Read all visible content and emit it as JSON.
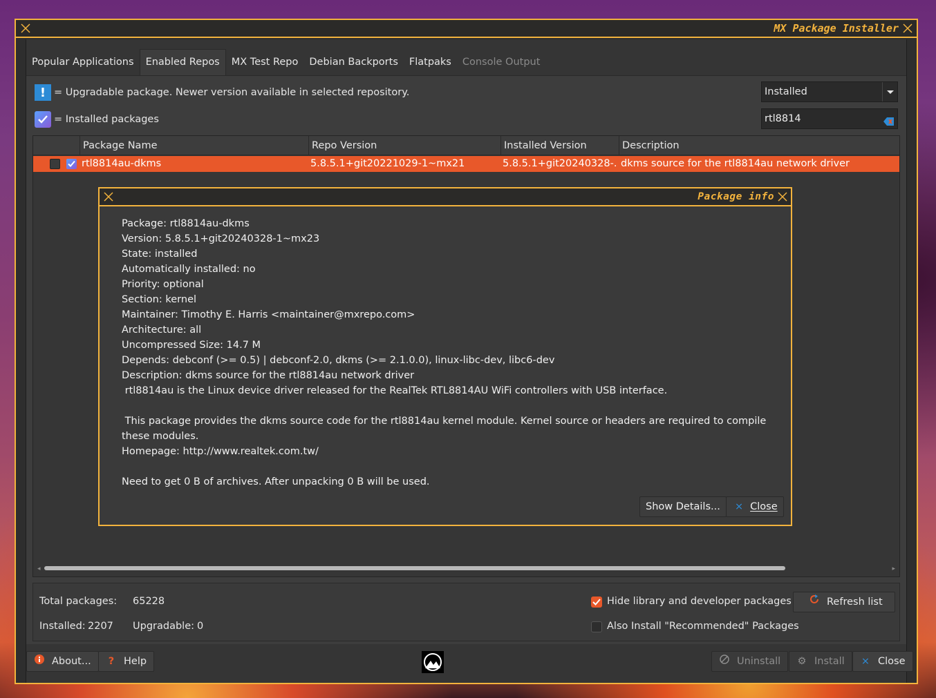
{
  "window": {
    "title": "MX Package Installer"
  },
  "tabs": [
    {
      "label": "Popular Applications"
    },
    {
      "label": "Enabled Repos"
    },
    {
      "label": "MX Test Repo"
    },
    {
      "label": "Debian Backports"
    },
    {
      "label": "Flatpaks"
    },
    {
      "label": "Console Output"
    }
  ],
  "legend": {
    "upgradable_icon": "!",
    "upgradable": "= Upgradable package. Newer version available in selected repository.",
    "installed": "= Installed packages"
  },
  "filter": {
    "selected": "Installed"
  },
  "search": {
    "value": "rtl8814"
  },
  "table": {
    "headers": [
      "Package Name",
      "Repo Version",
      "Installed Version",
      "Description"
    ],
    "rows": [
      {
        "name": "rtl8814au-dkms",
        "repo_version": "5.8.5.1+git20221029-1~mx21",
        "installed_version": "5.8.5.1+git20240328-...",
        "description": "dkms source for the rtl8814au network driver",
        "selected": false,
        "installed": true
      }
    ]
  },
  "stats": {
    "total_label": "Total packages:",
    "total_value": "65228",
    "installed_label": "Installed:",
    "installed_value": "2207",
    "upgradable_label": "Upgradable:",
    "upgradable_value": "0"
  },
  "options": {
    "hide_lib": "Hide library and developer packages",
    "hide_lib_checked": true,
    "recommended": "Also Install \"Recommended\" Packages",
    "recommended_checked": false
  },
  "buttons": {
    "refresh": "Refresh list",
    "about": "About...",
    "help": "Help",
    "uninstall": "Uninstall",
    "install": "Install",
    "close": "Close"
  },
  "dialog": {
    "title": "Package info",
    "lines": [
      "Package: rtl8814au-dkms",
      "Version: 5.8.5.1+git20240328-1~mx23",
      "State: installed",
      "Automatically installed: no",
      "Priority: optional",
      "Section: kernel",
      "Maintainer: Timothy E. Harris <maintainer@mxrepo.com>",
      "Architecture: all",
      "Uncompressed Size: 14.7 M",
      "Depends: debconf (>= 0.5) | debconf-2.0, dkms (>= 2.1.0.0), linux-libc-dev, libc6-dev",
      "Description: dkms source for the rtl8814au network driver",
      " rtl8814au is the Linux device driver released for the RealTek RTL8814AU WiFi controllers with USB interface.",
      " ",
      " This package provides the dkms source code for the rtl8814au kernel module. Kernel source or headers are required to compile these modules.",
      "Homepage: http://www.realtek.com.tw/",
      " ",
      "Need to get 0 B of archives. After unpacking 0 B will be used."
    ],
    "show_details": "Show Details...",
    "close": "Close"
  },
  "colors": {
    "accent": "#f3b33d",
    "selection": "#e8582a",
    "upgradable_icon": "#2d8bd6"
  }
}
